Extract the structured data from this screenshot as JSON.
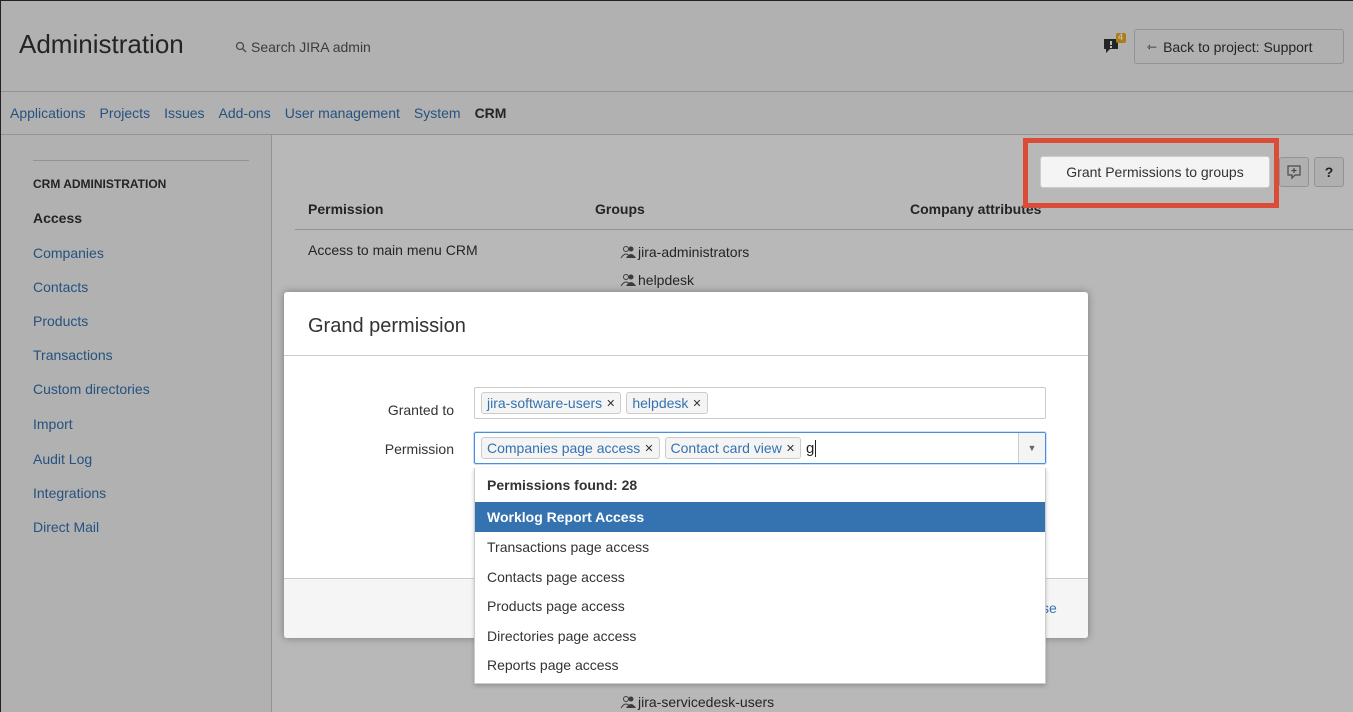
{
  "header": {
    "title": "Administration",
    "search_placeholder": "Search JIRA admin",
    "notification_count": "4",
    "back_label": "Back to project: Support"
  },
  "nav": {
    "items": [
      "Applications",
      "Projects",
      "Issues",
      "Add-ons",
      "User management",
      "System",
      "CRM"
    ],
    "active": "CRM"
  },
  "sidebar": {
    "section": "CRM ADMINISTRATION",
    "items": [
      "Access",
      "Companies",
      "Contacts",
      "Products",
      "Transactions",
      "Custom directories",
      "Import",
      "Audit Log",
      "Integrations",
      "Direct Mail"
    ],
    "active": "Access"
  },
  "main": {
    "grant_button": "Grant Permissions to groups",
    "help_label": "?",
    "columns": [
      "Permission",
      "Groups",
      "Company attributes"
    ],
    "rows": [
      {
        "permission": "Access to main menu CRM",
        "groups": [
          "jira-administrators",
          "helpdesk"
        ]
      }
    ],
    "bottom_group": "jira-servicedesk-users"
  },
  "dialog": {
    "title": "Grand permission",
    "granted_to_label": "Granted to",
    "granted_to_tags": [
      "jira-software-users",
      "helpdesk"
    ],
    "permission_label": "Permission",
    "permission_tags": [
      "Companies page access",
      "Contact card view"
    ],
    "typed_text": "g",
    "close_partial": "se"
  },
  "dropdown": {
    "header": "Permissions found: 28",
    "items": [
      "Worklog Report Access",
      "Transactions page access",
      "Contacts page access",
      "Products page access",
      "Directories page access",
      "Reports page access"
    ],
    "selected_index": 0
  },
  "colors": {
    "link": "#3572b0",
    "highlight_box": "#d94c38",
    "notification_badge": "#f0ad1e"
  }
}
